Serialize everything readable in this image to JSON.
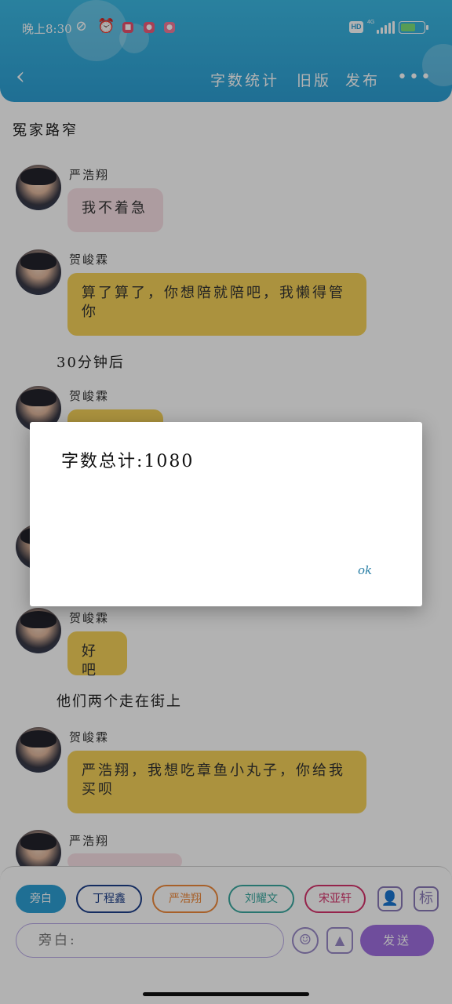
{
  "status_bar": {
    "time": "晚上8:30",
    "network": "4G",
    "hd_label": "HD"
  },
  "toolbar": {
    "word_count": "字数统计",
    "old_version": "旧版",
    "publish": "发布",
    "more": "•••"
  },
  "chat": {
    "title": "冤家路窄",
    "messages": [
      {
        "speaker": "严浩翔",
        "text": "我不着急"
      },
      {
        "speaker": "贺峻霖",
        "text": "算了算了，你想陪就陪吧，我懒得管你"
      },
      {
        "narration": "30分钟后"
      },
      {
        "speaker": "贺峻霖",
        "text": ""
      },
      {
        "speaker": "贺峻霖",
        "text": "好吧"
      },
      {
        "narration": "他们两个走在街上"
      },
      {
        "speaker": "贺峻霖",
        "text": "严浩翔，我想吃章鱼小丸子，你给我买呗"
      },
      {
        "speaker": "严浩翔",
        "text": ""
      }
    ]
  },
  "input_bar": {
    "roles": [
      "旁白",
      "丁程鑫",
      "严浩翔",
      "刘耀文",
      "宋亚轩"
    ],
    "input_placeholder": "旁白:",
    "send": "发送",
    "mark_icon_label": "标"
  },
  "dialog": {
    "message": "字数总计:1080",
    "ok": "ok"
  },
  "colors": {
    "header": "#2d9fd4",
    "bubble_yellow": "#f5d25a",
    "bubble_pink": "#f8e0e6",
    "send_button": "#9f6fe0",
    "role_colors": [
      "#2d9fd4",
      "#1e3f8a",
      "#ef8a3c",
      "#3aa8a0",
      "#d6336c"
    ]
  }
}
